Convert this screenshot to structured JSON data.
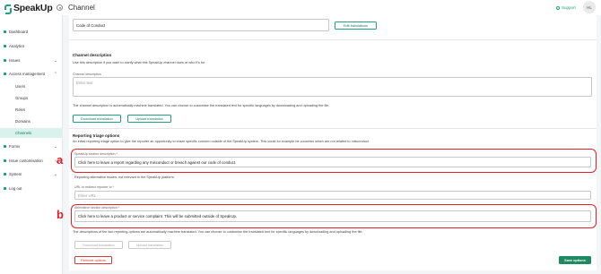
{
  "header": {
    "logo_text": "SpeakUp",
    "title": "Channel",
    "support_label": "Support",
    "avatar_initials": "HL"
  },
  "sidebar": {
    "items": [
      {
        "label": "Dashboard"
      },
      {
        "label": "Analytics"
      },
      {
        "label": "Issues"
      },
      {
        "label": "Access management"
      },
      {
        "label": "Users"
      },
      {
        "label": "Groups"
      },
      {
        "label": "Roles"
      },
      {
        "label": "Domains"
      },
      {
        "label": "Channels"
      },
      {
        "label": "Forms"
      },
      {
        "label": "Issue customisation",
        "badge": "Beta"
      },
      {
        "label": "System"
      },
      {
        "label": "Log out"
      }
    ]
  },
  "main": {
    "name_value": "Code of Conduct",
    "edit_translations_label": "Edit translations",
    "description_section_title": "Channel description",
    "description_help": "Use this description if you want to clarify what this SpeakUp channel does or who it's for",
    "description_label": "Channel description",
    "description_placeholder": "Enter text",
    "description_note": "The channel description is automatically machine translated. You can choose to customise the translated text for specific languages by downloading and uploading the file.",
    "download_translation_label": "Download translation",
    "upload_translation_label": "Upload translation",
    "triage_title": "Reporting triage options",
    "triage_help": "An initial reporting triage option to give the reporter an opportunity to share specific concern outside of the SpeakUp system. This could for example be concerns which are not related to misconduct.",
    "speakup_label": "SpeakUp section description *",
    "speakup_value": "Click here to leave a report regarding any misconduct or breach against our code of conduct.",
    "alt_issues_note": "Reporting alternative issues, not relevant to the SpeakUp platform.",
    "url_label": "URL to redirect reporter to *",
    "url_placeholder": "Enter URL",
    "alt_label": "Alternative section description *",
    "alt_value": "Click here to leave a product or service complaint. This will be submitted outside of SpeakUp.",
    "triage_note": "The descriptions of the two reporting options are automatically machine translated. You can choose to customise the translated text for specific languages by downloading and uploading the file.",
    "download_translation_disabled_label": "Download translation",
    "upload_translation_disabled_label": "Upload translation",
    "remove_options_label": "Remove options",
    "save_options_label": "Save options"
  },
  "annotations": {
    "a": "a",
    "b": "b"
  },
  "colors": {
    "brand": "#1fa37a",
    "annotation": "#e2202a",
    "active_nav_bg": "#d9f2ec"
  }
}
